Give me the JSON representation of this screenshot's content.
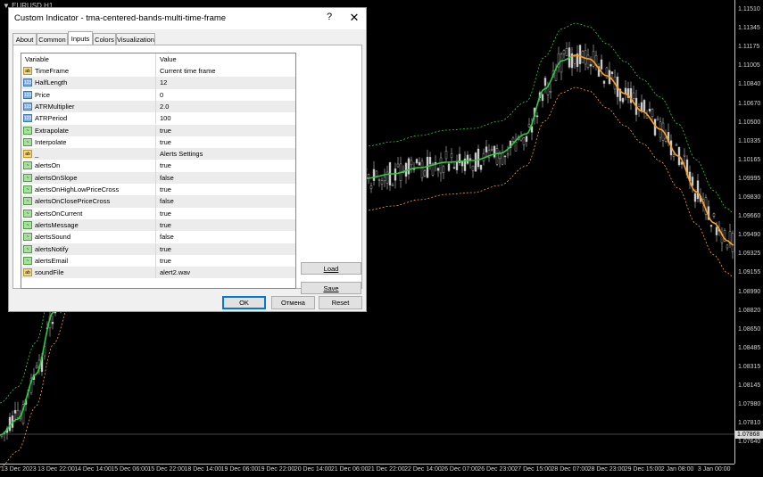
{
  "chart": {
    "symbol": "EURUSD,H1",
    "price_labels": [
      "1.11510",
      "1.11345",
      "1.11175",
      "1.11005",
      "1.10840",
      "1.10670",
      "1.10500",
      "1.10335",
      "1.10165",
      "1.09995",
      "1.09830",
      "1.09660",
      "1.09490",
      "1.09325",
      "1.09155",
      "1.08990",
      "1.08820",
      "1.08650",
      "1.08485",
      "1.08315",
      "1.08145",
      "1.07980",
      "1.07810",
      "1.07640"
    ],
    "current_price": "1.07868",
    "time_labels": [
      "13 Dec 2023",
      "13 Dec 22:00",
      "14 Dec 14:00",
      "15 Dec 06:00",
      "15 Dec 22:00",
      "18 Dec 14:00",
      "19 Dec 06:00",
      "19 Dec 22:00",
      "20 Dec 14:00",
      "21 Dec 06:00",
      "21 Dec 22:00",
      "22 Dec 14:00",
      "26 Dec 07:00",
      "26 Dec 23:00",
      "27 Dec 15:00",
      "28 Dec 07:00",
      "28 Dec 23:00",
      "29 Dec 15:00",
      "2 Jan 08:00",
      "3 Jan 00:00"
    ],
    "colors": {
      "mid_up": "#2ecc40",
      "mid_down": "#ff9f1c",
      "band_upper": "#2ecc40",
      "band_lower": "#ff9f1c",
      "candle": "#c8c8c8"
    }
  },
  "dialog": {
    "title": "Custom Indicator - tma-centered-bands-multi-time-frame",
    "help": "?",
    "close": "✕",
    "tabs": [
      "About",
      "Common",
      "Inputs",
      "Colors",
      "Visualization"
    ],
    "active_tab": "Inputs",
    "columns": {
      "variable": "Variable",
      "value": "Value"
    },
    "params": [
      {
        "type": "ab",
        "name": "TimeFrame",
        "value": "Current time frame"
      },
      {
        "type": "num",
        "name": "HalfLength",
        "value": "12"
      },
      {
        "type": "num",
        "name": "Price",
        "value": "0"
      },
      {
        "type": "num",
        "name": "ATRMultiplier",
        "value": "2.0"
      },
      {
        "type": "num",
        "name": "ATRPeriod",
        "value": "100"
      },
      {
        "type": "bool",
        "name": "Extrapolate",
        "value": "true"
      },
      {
        "type": "bool",
        "name": "Interpolate",
        "value": "true"
      },
      {
        "type": "ab",
        "name": "_",
        "value": "Alerts Settings"
      },
      {
        "type": "bool",
        "name": "alertsOn",
        "value": "true"
      },
      {
        "type": "bool",
        "name": "alertsOnSlope",
        "value": "false"
      },
      {
        "type": "bool",
        "name": "alertsOnHighLowPriceCross",
        "value": "true"
      },
      {
        "type": "bool",
        "name": "alertsOnClosePriceCross",
        "value": "false"
      },
      {
        "type": "bool",
        "name": "alertsOnCurrent",
        "value": "true"
      },
      {
        "type": "bool",
        "name": "alertsMessage",
        "value": "true"
      },
      {
        "type": "bool",
        "name": "alertsSound",
        "value": "false"
      },
      {
        "type": "bool",
        "name": "alertsNotify",
        "value": "true"
      },
      {
        "type": "bool",
        "name": "alertsEmail",
        "value": "true"
      },
      {
        "type": "ab",
        "name": "soundFile",
        "value": "alert2.wav"
      }
    ],
    "load_label": "Load",
    "save_label": "Save",
    "ok_label": "OK",
    "cancel_label": "Отмена",
    "reset_label": "Reset",
    "type_icons": {
      "ab": "ab",
      "num": "123",
      "bool": "~"
    }
  }
}
